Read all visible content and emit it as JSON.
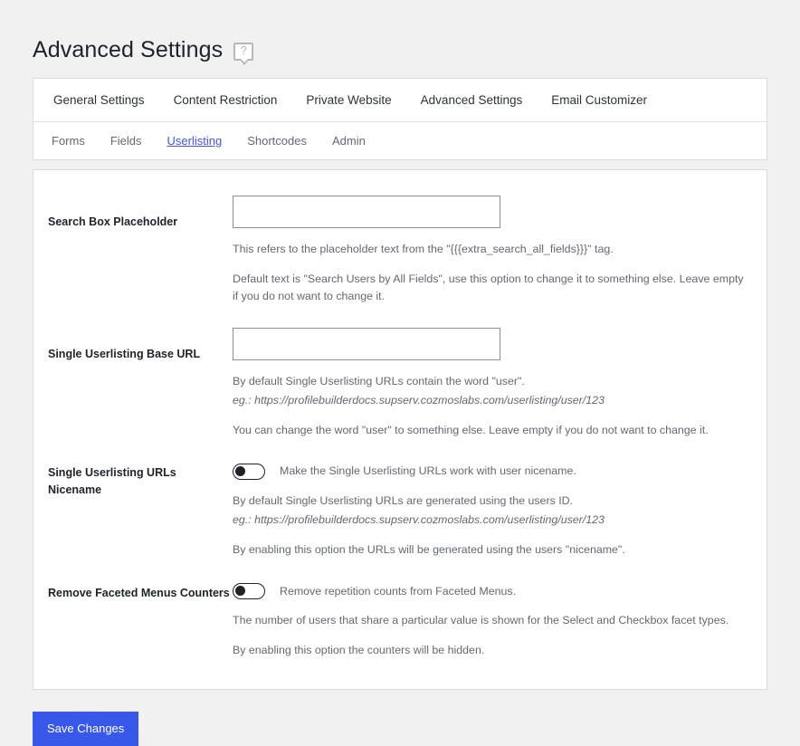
{
  "header": {
    "title": "Advanced Settings",
    "help_icon": "help-bubble-icon",
    "help_glyph": "?"
  },
  "tabs": {
    "primary": [
      {
        "label": "General Settings",
        "active": false
      },
      {
        "label": "Content Restriction",
        "active": false
      },
      {
        "label": "Private Website",
        "active": false
      },
      {
        "label": "Advanced Settings",
        "active": true
      },
      {
        "label": "Email Customizer",
        "active": false
      }
    ],
    "secondary": [
      {
        "label": "Forms",
        "active": false
      },
      {
        "label": "Fields",
        "active": false
      },
      {
        "label": "Userlisting",
        "active": true
      },
      {
        "label": "Shortcodes",
        "active": false
      },
      {
        "label": "Admin",
        "active": false
      }
    ]
  },
  "settings": {
    "search_box_placeholder": {
      "label": "Search Box Placeholder",
      "value": "",
      "placeholder": "",
      "desc1": "This refers to the placeholder text from the \"{{{extra_search_all_fields}}}\" tag.",
      "desc2": "Default text is \"Search Users by All Fields\", use this option to change it to something else. Leave empty if you do not want to change it."
    },
    "single_userlisting_base_url": {
      "label": "Single Userlisting Base URL",
      "value": "",
      "placeholder": "",
      "desc1": "By default Single Userlisting URLs contain the word \"user\".",
      "desc_example": "eg.: https://profilebuilderdocs.supserv.cozmoslabs.com/userlisting/user/123",
      "desc2": "You can change the word \"user\" to something else. Leave empty if you do not want to change it."
    },
    "single_userlisting_urls_nicename": {
      "label": "Single Userlisting URLs Nicename",
      "toggle_state": "off",
      "toggle_text": "Make the Single Userlisting URLs work with user nicename.",
      "desc1": "By default Single Userlisting URLs are generated using the users ID.",
      "desc_example": "eg.: https://profilebuilderdocs.supserv.cozmoslabs.com/userlisting/user/123",
      "desc2": "By enabling this option the URLs will be generated using the users \"nicename\"."
    },
    "remove_faceted_menus_counters": {
      "label": "Remove Faceted Menus Counters",
      "toggle_state": "off",
      "toggle_text": "Remove repetition counts from Faceted Menus.",
      "desc1": "The number of users that share a particular value is shown for the Select and Checkbox facet types.",
      "desc2": "By enabling this option the counters will be hidden."
    }
  },
  "actions": {
    "save_label": "Save Changes"
  },
  "colors": {
    "page_background": "#f1f1f1",
    "card_background": "#ffffff",
    "card_border": "#dcdcde",
    "accent": "#3858e9",
    "active_tab_link": "#4353e8",
    "text_primary": "#1d2327",
    "text_muted": "#646970",
    "input_border": "#8c8f94"
  }
}
